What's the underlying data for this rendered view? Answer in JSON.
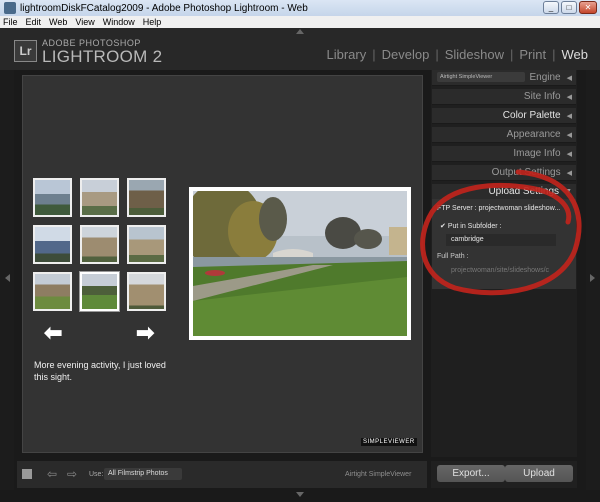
{
  "window": {
    "title": "lightroomDiskFCatalog2009 - Adobe Photoshop Lightroom - Web",
    "minimize": "_",
    "maximize": "□",
    "close": "✕"
  },
  "menu": [
    "File",
    "Edit",
    "Web",
    "View",
    "Window",
    "Help"
  ],
  "header": {
    "brand_small": "ADOBE PHOTOSHOP",
    "brand_big": "LIGHTROOM 2",
    "logo": "Lr",
    "modules": [
      "Library",
      "Develop",
      "Slideshow",
      "Print",
      "Web"
    ],
    "active_module": "Web"
  },
  "gallery": {
    "caption": "More evening activity, I just loved this sight.",
    "badge": "SIMPLEVIEWER",
    "prev_arrow": "⬅",
    "next_arrow": "➡"
  },
  "right_panel": {
    "engine_select": "Airtight SimpleViewer",
    "sections": [
      {
        "label": "Engine",
        "expanded": false
      },
      {
        "label": "Site Info",
        "expanded": false
      },
      {
        "label": "Color Palette",
        "expanded": true
      },
      {
        "label": "Appearance",
        "expanded": false
      },
      {
        "label": "Image Info",
        "expanded": false
      },
      {
        "label": "Output Settings",
        "expanded": false
      },
      {
        "label": "Upload Settings",
        "expanded": true
      }
    ],
    "upload": {
      "ftp_label": "FTP Server : ",
      "ftp_value": "projectwoman slideshow...",
      "check_mark": "✔",
      "subfolder_label": "Put in Subfolder :",
      "subfolder_value": "cambridge",
      "full_path_label": "Full Path :",
      "full_path_value": "projectwoman/site/slideshows/c"
    },
    "export_button": "Export...",
    "upload_button": "Upload"
  },
  "bottom": {
    "use_label": "Use:",
    "use_value": "All Filmstrip Photos",
    "prev": "⇦",
    "next": "⇨",
    "engine": "Airtight SimpleViewer"
  },
  "colors": {
    "annotation": "#c0241c",
    "panel_bg": "#2b2b2b"
  }
}
